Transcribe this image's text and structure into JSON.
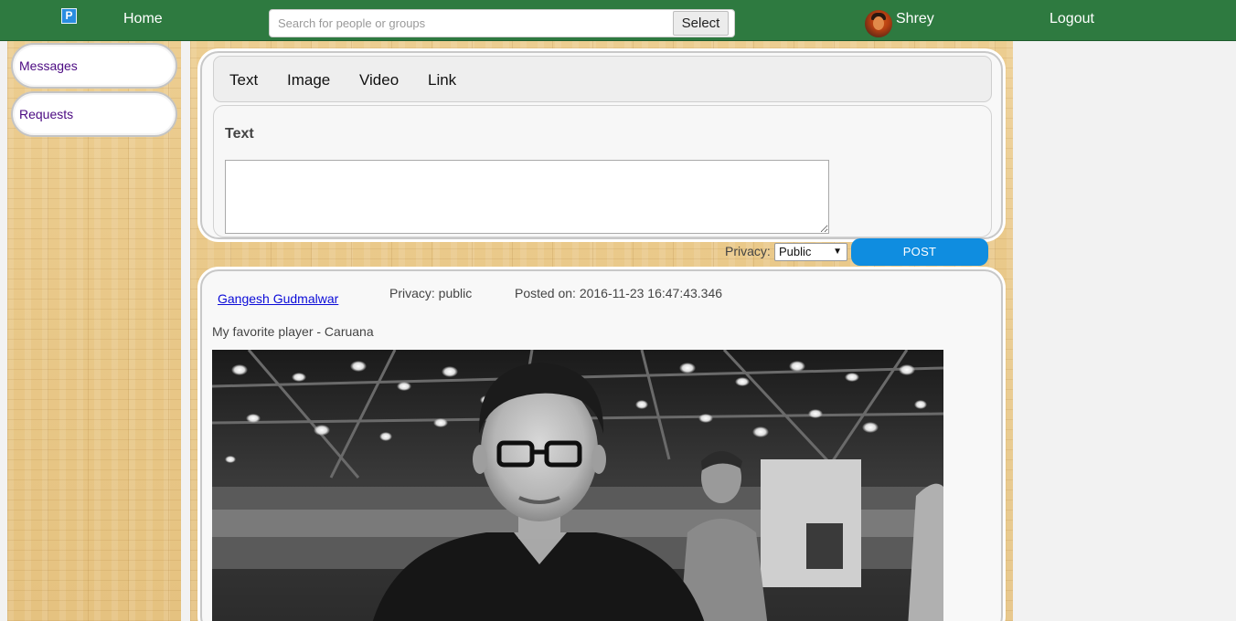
{
  "nav": {
    "logo_letter": "P",
    "home": "Home",
    "search_placeholder": "Search for people or groups",
    "search_button": "Select",
    "user_name": "Shrey",
    "logout": "Logout"
  },
  "sidebar": {
    "items": [
      {
        "label": "Messages"
      },
      {
        "label": "Requests"
      }
    ]
  },
  "composer": {
    "tabs": [
      {
        "label": "Text"
      },
      {
        "label": "Image"
      },
      {
        "label": "Video"
      },
      {
        "label": "Link"
      }
    ],
    "form_heading": "Text",
    "textarea_value": "",
    "privacy_label": "Privacy:",
    "privacy_value": "Public",
    "post_button": "POST"
  },
  "feed": {
    "posts": [
      {
        "author": "Gangesh Gudmalwar",
        "privacy": "Privacy: public",
        "posted_on": "Posted on: 2016-11-23 16:47:43.346",
        "caption": "My favorite player - Caruana",
        "image_alt": "Caruana-photo"
      }
    ]
  },
  "colors": {
    "navbar": "#2e7a40",
    "post_button": "#0f8de0",
    "sidebar_link": "#4b0a82",
    "author_link": "#0b0bd8"
  }
}
